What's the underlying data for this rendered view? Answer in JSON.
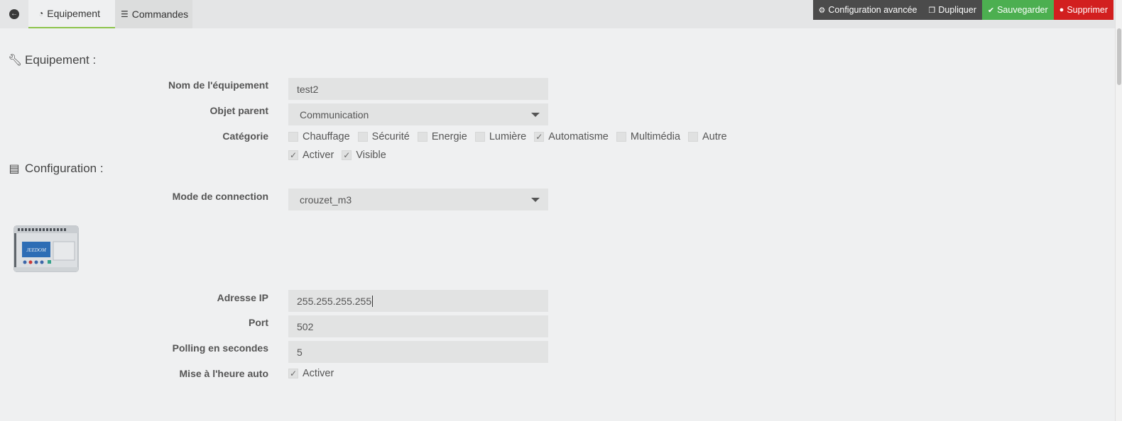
{
  "tabs": [
    {
      "label": "Equipement",
      "icon": "dashboard-icon"
    },
    {
      "label": "Commandes",
      "icon": "list-icon"
    }
  ],
  "actions": {
    "config_label": "Configuration avancée",
    "duplicate_label": "Dupliquer",
    "save_label": "Sauvegarder",
    "delete_label": "Supprimer"
  },
  "colors": {
    "save": "#4caf50",
    "delete": "#d21f1f",
    "dark_button": "#4b4b4b",
    "active_tab_underline": "#8cc34a"
  },
  "equipment_section": {
    "title": "Equipement :",
    "name_label": "Nom de l'équipement",
    "name_value": "test2",
    "parent_label": "Objet parent",
    "parent_value": "Communication",
    "category_label": "Catégorie",
    "categories": [
      {
        "label": "Chauffage",
        "checked": false
      },
      {
        "label": "Sécurité",
        "checked": false
      },
      {
        "label": "Energie",
        "checked": false
      },
      {
        "label": "Lumière",
        "checked": false
      },
      {
        "label": "Automatisme",
        "checked": true
      },
      {
        "label": "Multimédia",
        "checked": false
      },
      {
        "label": "Autre",
        "checked": false
      }
    ],
    "activate_label": "Activer",
    "visible_label": "Visible"
  },
  "configuration_section": {
    "title": "Configuration :",
    "mode_label": "Mode de connection",
    "mode_value": "crouzet_m3",
    "device_screen_text": "JEEDOM",
    "ip_label": "Adresse IP",
    "ip_value": "255.255.255.255",
    "port_label": "Port",
    "port_value": "502",
    "polling_label": "Polling en secondes",
    "polling_value": "5",
    "autotime_label": "Mise à l'heure auto",
    "autotime_check_label": "Activer"
  }
}
